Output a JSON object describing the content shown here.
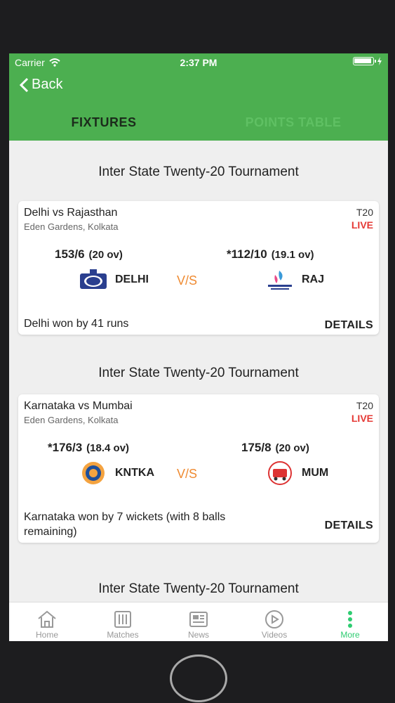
{
  "status": {
    "carrier": "Carrier",
    "time": "2:37 PM"
  },
  "header": {
    "back_label": "Back"
  },
  "tabs": [
    {
      "label": "FIXTURES"
    },
    {
      "label": "POINTS TABLE"
    }
  ],
  "matches": [
    {
      "section_title": "Inter State Twenty-20 Tournament",
      "title": "Delhi vs Rajasthan",
      "venue": "Eden Gardens, Kolkata",
      "format": "T20",
      "status": "LIVE",
      "team1": {
        "score": "153/6",
        "overs": "(20 ov)",
        "short": "DELHI"
      },
      "team2": {
        "score": "*112/10",
        "overs": "(19.1 ov)",
        "short": "RAJ"
      },
      "vs": "V/S",
      "result": "Delhi won by 41 runs",
      "details_label": "DETAILS"
    },
    {
      "section_title": "Inter State Twenty-20 Tournament",
      "title": "Karnataka vs Mumbai",
      "venue": "Eden Gardens, Kolkata",
      "format": "T20",
      "status": "LIVE",
      "team1": {
        "score": "*176/3",
        "overs": "(18.4 ov)",
        "short": "KNTKA"
      },
      "team2": {
        "score": "175/8",
        "overs": "(20 ov)",
        "short": "MUM"
      },
      "vs": "V/S",
      "result": "Karnataka won by 7 wickets (with 8 balls remaining)",
      "details_label": "DETAILS"
    }
  ],
  "next_section_title": "Inter State Twenty-20 Tournament",
  "bottom_nav": [
    {
      "label": "Home",
      "icon": "home-icon"
    },
    {
      "label": "Matches",
      "icon": "matches-icon"
    },
    {
      "label": "News",
      "icon": "news-icon"
    },
    {
      "label": "Videos",
      "icon": "play-icon"
    },
    {
      "label": "More",
      "icon": "more-icon"
    }
  ],
  "colors": {
    "header": "#4caf50",
    "live": "#e53935",
    "vs": "#ef8b32",
    "active_nav": "#2ecc71"
  }
}
